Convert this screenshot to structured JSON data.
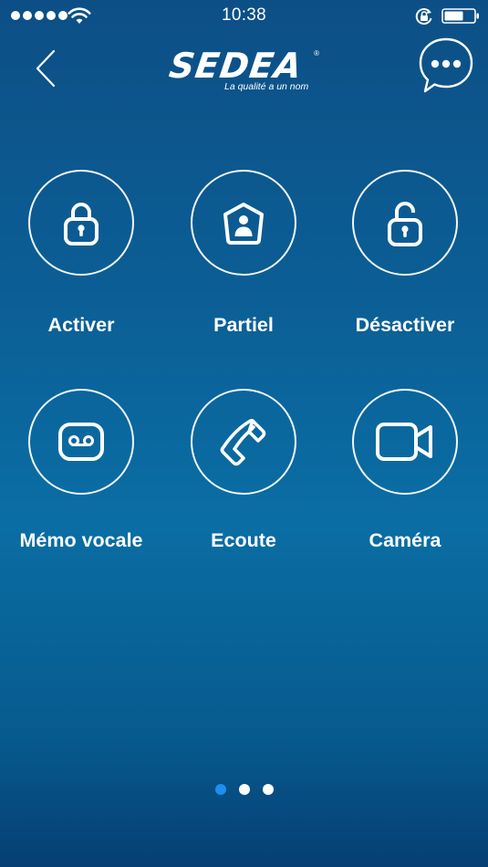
{
  "status_bar": {
    "time": "10:38",
    "signal_icon": "signal-dots-icon",
    "wifi_icon": "wifi-icon",
    "rotation_lock_icon": "rotation-lock-icon",
    "battery_icon": "battery-icon"
  },
  "nav": {
    "back_icon": "chevron-left-icon",
    "logo_text": "SEDEA",
    "logo_registered": "®",
    "logo_tagline": "La qualité a un nom",
    "chat_icon": "chat-bubble-icon"
  },
  "actions": [
    {
      "label": "Activer",
      "icon": "lock-icon"
    },
    {
      "label": "Partiel",
      "icon": "home-user-icon"
    },
    {
      "label": "Désactiver",
      "icon": "unlock-icon"
    },
    {
      "label": "Mémo vocale",
      "icon": "voicemail-icon"
    },
    {
      "label": "Ecoute",
      "icon": "phone-icon"
    },
    {
      "label": "Caméra",
      "icon": "video-camera-icon"
    }
  ],
  "pagination": {
    "pages": 3,
    "current": 1
  },
  "colors": {
    "background_top": "#0c4f86",
    "background_mid": "#0a6ea4",
    "active_dot": "#1d8ef0",
    "foreground": "#ffffff"
  }
}
